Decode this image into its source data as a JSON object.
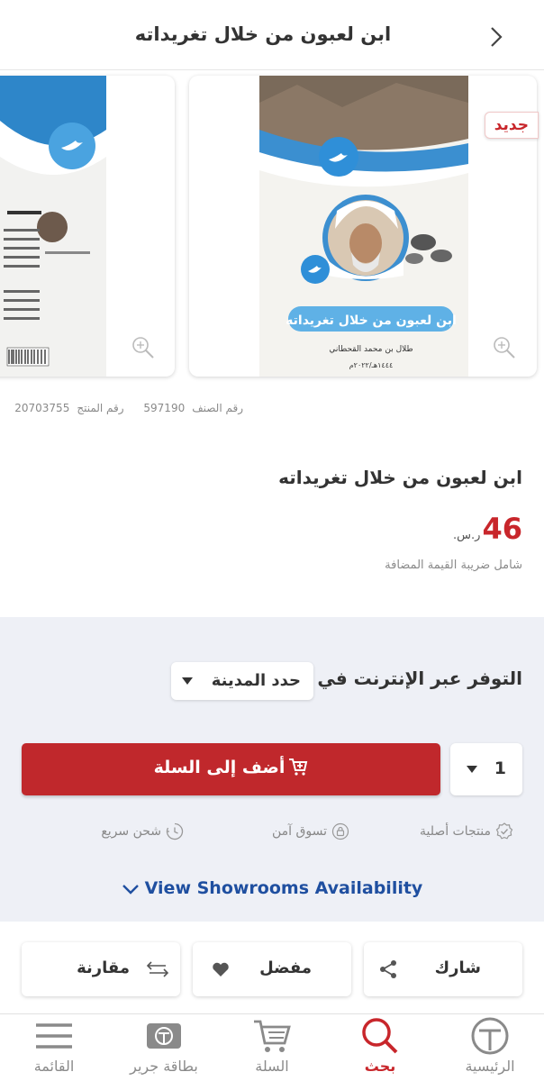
{
  "header": {
    "title": "ابن لعبون من خلال تغريداته"
  },
  "gallery": {
    "badge": "جديد",
    "cover": {
      "title": "ابن لعبون من خلال تغريداته",
      "author": "طلال بن محمد القحطاني",
      "year": "١٤٤٤هـ/٢٠٢٢م"
    }
  },
  "product": {
    "class_label": "رقم الصنف",
    "class_number": "597190",
    "product_label": "رقم المنتج",
    "product_number": "20703755",
    "title": "ابن لعبون من خلال تغريداته",
    "price": "46",
    "currency": "ر.س.",
    "vat_note": "شامل ضريبة القيمة المضافة"
  },
  "availability": {
    "label": "التوفر عبر الإنترنت في",
    "city_placeholder": "حدد المدينة",
    "quantity": "1",
    "add_to_cart": "أضف إلى السلة",
    "features": [
      {
        "label": "منتجات أصلية",
        "icon": "verified-badge-icon"
      },
      {
        "label": "تسوق آمن",
        "icon": "lock-icon"
      },
      {
        "label": "شحن سريع",
        "icon": "fast-clock-icon"
      }
    ],
    "showrooms_link": "View Showrooms Availability"
  },
  "actions": {
    "share": "شارك",
    "favorite": "مفضل",
    "compare": "مقارنة"
  },
  "tabbar": {
    "home": "الرئيسية",
    "search": "بحث",
    "cart": "السلة",
    "jarir_card": "بطاقة جرير",
    "menu": "القائمة"
  },
  "colors": {
    "brand_red": "#c0282c",
    "link_blue": "#1f4fa0",
    "panel_bg": "#eef0f6"
  }
}
